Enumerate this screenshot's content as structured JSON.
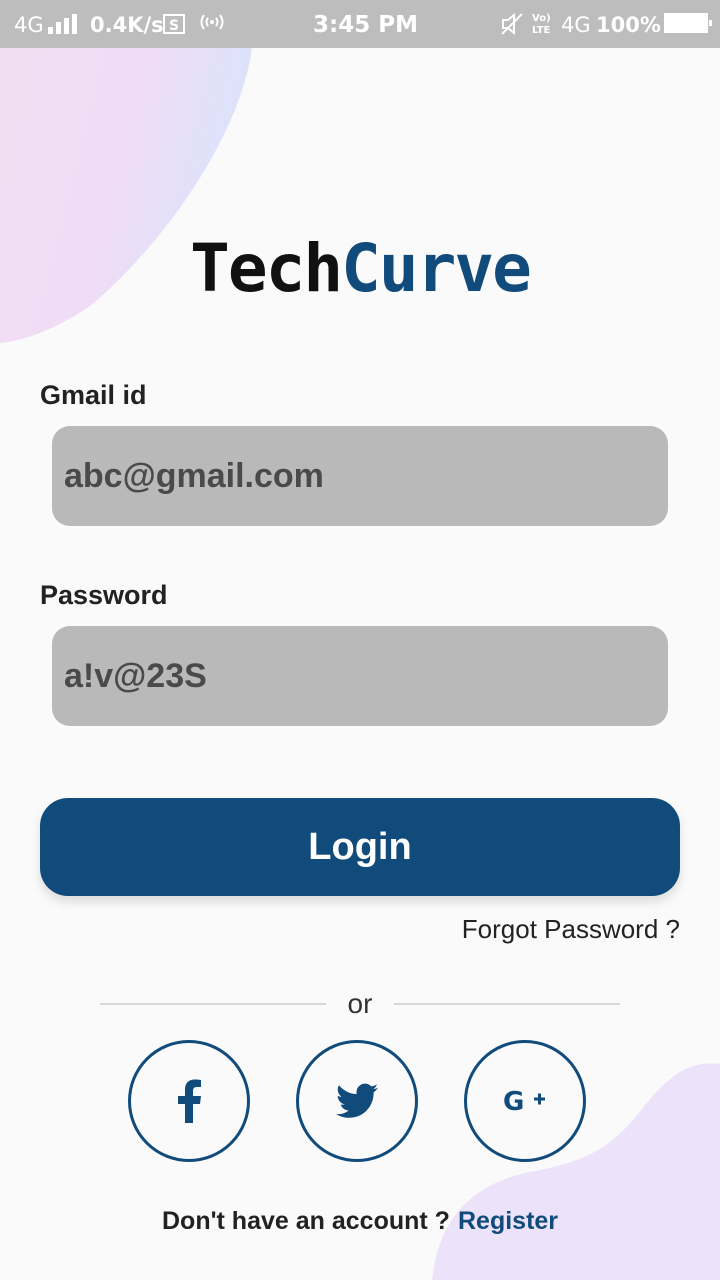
{
  "status_bar": {
    "network_left": "4G",
    "speed": "0.4K/s",
    "time": "3:45 PM",
    "volte": "Vo) LTE",
    "network_right": "4G",
    "battery": "100%"
  },
  "logo": {
    "part1": "Tech",
    "part2": "Curve"
  },
  "form": {
    "email_label": "Gmail id",
    "email_value": "abc@gmail.com",
    "password_label": "Password",
    "password_value": "a!v@23S"
  },
  "login_button": "Login",
  "forgot_password": "Forgot Password ?",
  "or_text": "or",
  "social": {
    "facebook": "facebook-icon",
    "twitter": "twitter-icon",
    "google_plus": "google-plus-icon"
  },
  "footer": {
    "prompt": "Don't have an account ?",
    "register": "Register"
  },
  "colors": {
    "brand": "#104b7c",
    "input_bg": "#b9b9b9",
    "status_bar": "#bdbdbd"
  }
}
